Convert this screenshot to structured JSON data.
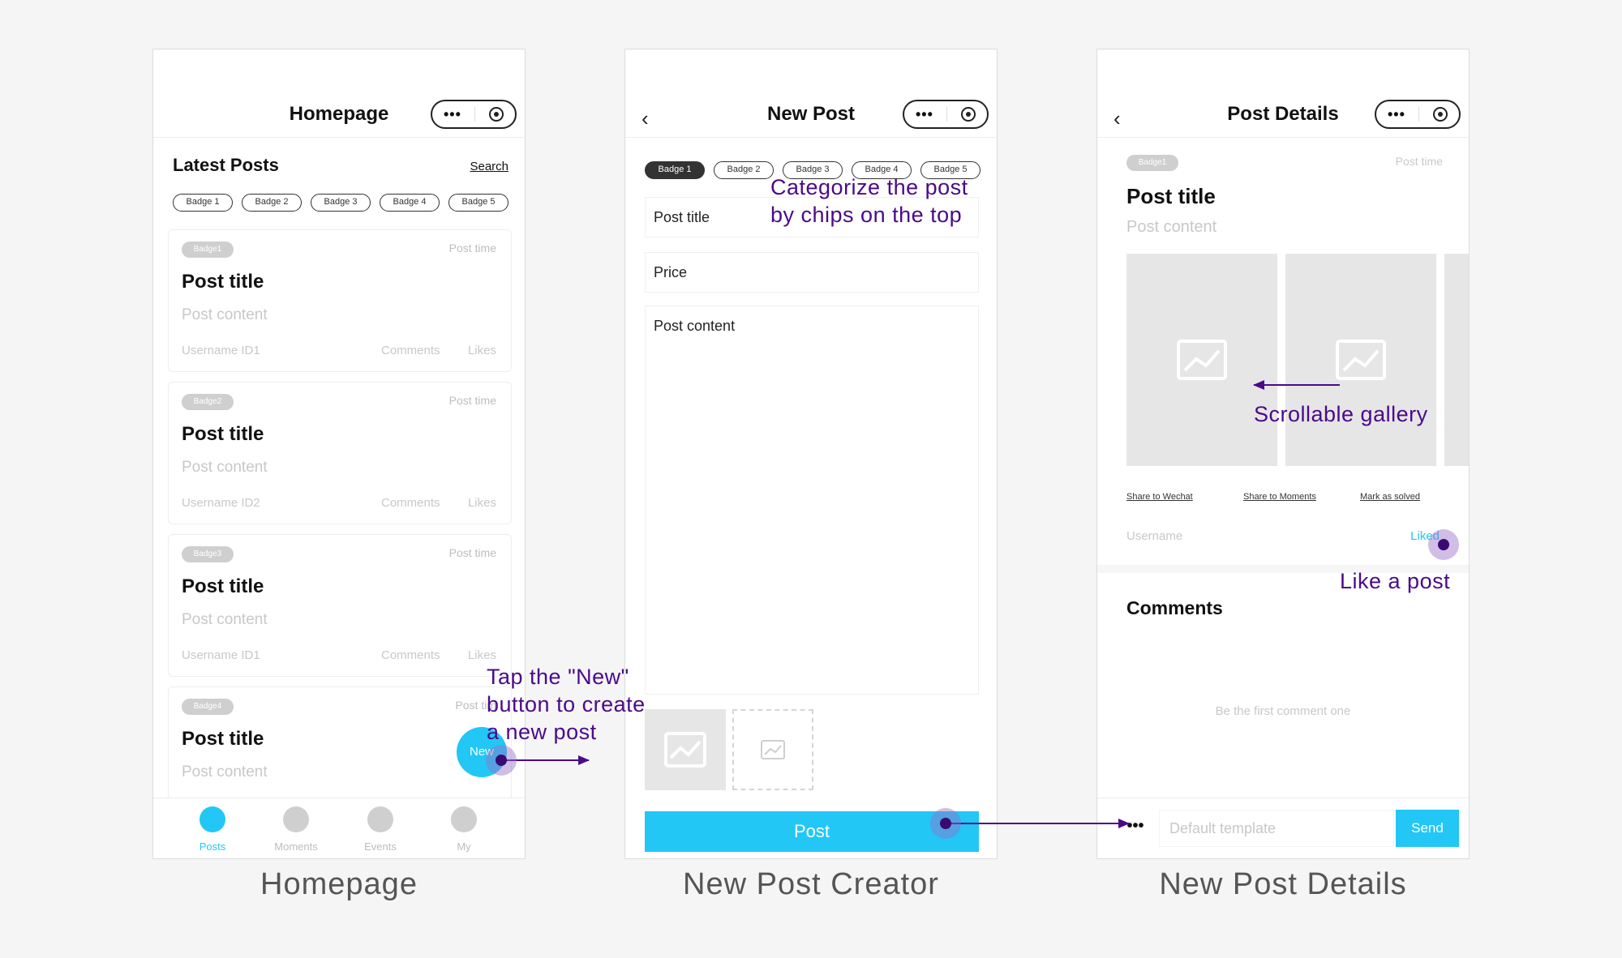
{
  "captions": [
    "Homepage",
    "New Post Creator",
    "New Post Details"
  ],
  "home": {
    "nav_title": "Homepage",
    "section_title": "Latest Posts",
    "search_label": "Search",
    "chips": [
      "Badge 1",
      "Badge 2",
      "Badge 3",
      "Badge 4",
      "Badge 5"
    ],
    "posts": [
      {
        "badge": "Badge1",
        "time": "Post time",
        "title": "Post title",
        "content": "Post content",
        "user": "Username ID1",
        "comments": "Comments",
        "likes": "Likes"
      },
      {
        "badge": "Badge2",
        "time": "Post time",
        "title": "Post title",
        "content": "Post content",
        "user": "Username ID2",
        "comments": "Comments",
        "likes": "Likes"
      },
      {
        "badge": "Badge3",
        "time": "Post time",
        "title": "Post title",
        "content": "Post content",
        "user": "Username ID1",
        "comments": "Comments",
        "likes": "Likes"
      },
      {
        "badge": "Badge4",
        "time": "Post tim",
        "title": "Post title",
        "content": "Post content"
      }
    ],
    "fab_label": "New",
    "tabs": [
      "Posts",
      "Moments",
      "Events",
      "My"
    ]
  },
  "newpost": {
    "nav_title": "New Post",
    "chips": [
      "Badge 1",
      "Badge 2",
      "Badge 3",
      "Badge 4",
      "Badge 5"
    ],
    "title_field": "Post title",
    "price_field": "Price",
    "content_field": "Post content",
    "post_button": "Post"
  },
  "details": {
    "nav_title": "Post Details",
    "badge": "Badge1",
    "time": "Post time",
    "title": "Post title",
    "content": "Post content",
    "share_wechat": "Share to Wechat",
    "share_moments": "Share to Moments",
    "mark_solved": "Mark as solved",
    "username": "Username",
    "liked": "Liked",
    "comments_title": "Comments",
    "empty_comments": "Be the first comment one",
    "input_placeholder": "Default template",
    "send_label": "Send"
  },
  "annotations": {
    "categorize": [
      "Categorize the post",
      "by chips on the top"
    ],
    "tap_new": [
      "Tap the \"New\"",
      "button to create",
      "a new post"
    ],
    "gallery": "Scrollable gallery",
    "like": "Like a post"
  },
  "colors": {
    "accent": "#22c7f5",
    "annotation": "#4a0a8a",
    "chip_active": "#333333"
  }
}
